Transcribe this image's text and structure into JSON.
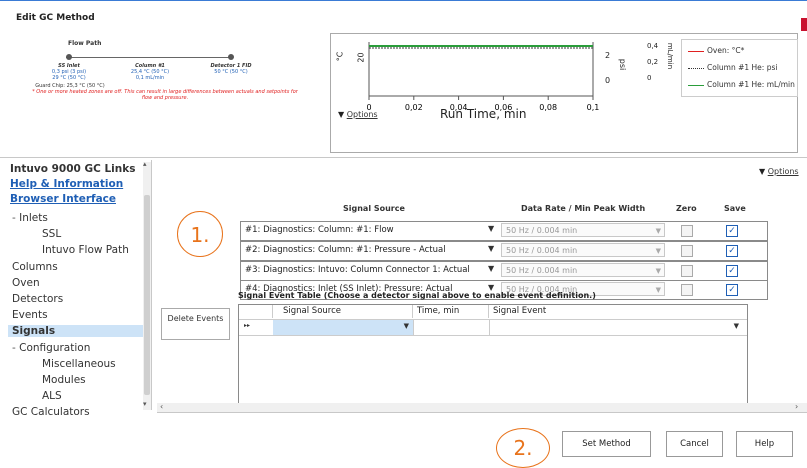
{
  "window": {
    "title": "Edit GC Method"
  },
  "flow_path": {
    "title": "Flow Path",
    "inlet": {
      "name": "SS Inlet",
      "pressure": "0,3 psi (3 psi)",
      "temp": "29 °C (50 °C)"
    },
    "column": {
      "name": "Column #1",
      "temp": "25,4 °C (50 °C)",
      "flow": "0,1 mL/min"
    },
    "detector": {
      "name": "Detector 1 FID",
      "temp": "50 °C (50 °C)"
    },
    "guard_chip": "Guard Chip: 25,3 °C (50 °C)",
    "warning": "* One or more heated zones are off. This can result in large differences between actuals and setpoints for flow and pressure."
  },
  "plot": {
    "left_axis_label": "°C",
    "left_tick": "20",
    "right_axis_label": "psi",
    "right_ticks": [
      "2",
      "0"
    ],
    "right2_axis_label": "mL/min",
    "right2_ticks": [
      "0,4",
      "0,2",
      "0"
    ],
    "x_ticks": [
      "0",
      "0,02",
      "0,04",
      "0,06",
      "0,08",
      "0,1"
    ],
    "x_label": "Run Time, min",
    "options_label": "Options",
    "legend": [
      {
        "label": "Oven: °C*",
        "color": "#e02020",
        "style": "solid"
      },
      {
        "label": "Column #1 He: psi",
        "color": "#333333",
        "style": "dotted"
      },
      {
        "label": "Column #1 He: mL/min",
        "color": "#2a9d3a",
        "style": "solid"
      }
    ]
  },
  "nav": {
    "header": "Intuvo 9000 GC Links",
    "links": [
      "Help & Information",
      "Browser Interface"
    ],
    "items": [
      {
        "label": "Inlets",
        "level": 0,
        "expander": "-"
      },
      {
        "label": "SSL",
        "level": 2
      },
      {
        "label": "Intuvo Flow Path",
        "level": 2
      },
      {
        "label": "Columns",
        "level": 1
      },
      {
        "label": "Oven",
        "level": 1
      },
      {
        "label": "Detectors",
        "level": 1
      },
      {
        "label": "Events",
        "level": 1
      },
      {
        "label": "Signals",
        "level": 1,
        "selected": true
      },
      {
        "label": "Configuration",
        "level": 0,
        "expander": "-"
      },
      {
        "label": "Miscellaneous",
        "level": 2
      },
      {
        "label": "Modules",
        "level": 2
      },
      {
        "label": "ALS",
        "level": 2
      },
      {
        "label": "GC Calculators",
        "level": 1
      }
    ]
  },
  "signals": {
    "options_label": "Options",
    "headers": {
      "source": "Signal Source",
      "rate": "Data Rate / Min Peak Width",
      "zero": "Zero",
      "save": "Save"
    },
    "rows": [
      {
        "source": "#1: Diagnostics: Column: #1: Flow",
        "rate": "50 Hz / 0.004 min",
        "zero": false,
        "save": true
      },
      {
        "source": "#2: Diagnostics: Column: #1: Pressure - Actual",
        "rate": "50 Hz / 0.004 min",
        "zero": false,
        "save": true
      },
      {
        "source": "#3: Diagnostics: Intuvo: Column Connector 1: Actual",
        "rate": "50 Hz / 0.004 min",
        "zero": false,
        "save": true
      },
      {
        "source": "#4: Diagnostics: Inlet (SS Inlet): Pressure: Actual",
        "rate": "50 Hz / 0.004 min",
        "zero": false,
        "save": true
      }
    ]
  },
  "event_table": {
    "title": "Signal Event Table (Choose a detector signal above to enable event definition.)",
    "delete_label": "Delete Events",
    "headers": [
      "Signal Source",
      "Time, min",
      "Signal Event"
    ],
    "row_marker": "▸▸"
  },
  "callouts": [
    "1.",
    "2."
  ],
  "buttons": {
    "set_method": "Set Method",
    "cancel": "Cancel",
    "help": "Help"
  }
}
